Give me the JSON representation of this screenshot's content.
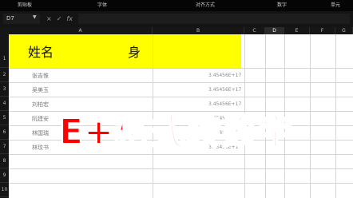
{
  "ribbon": {
    "groups": [
      "剪贴板",
      "字体",
      "对齐方式",
      "数字",
      "单元"
    ]
  },
  "formula_bar": {
    "name_box": "D7",
    "cancel": "×",
    "confirm": "✓",
    "fx": "fx"
  },
  "columns": [
    "A",
    "B",
    "C",
    "D",
    "E",
    "F",
    "G"
  ],
  "rows": [
    "1",
    "2",
    "3",
    "4",
    "5",
    "6",
    "7",
    "8",
    "9",
    "10"
  ],
  "header": {
    "name": "姓名",
    "id": "身"
  },
  "records": [
    {
      "name": "张吉惟",
      "id": "3.45456E+17"
    },
    {
      "name": "吴美玉",
      "id": "3.45456E+17"
    },
    {
      "name": "刘柏宏",
      "id": "3.45456E+17"
    },
    {
      "name": "阮建安",
      "id": "3.45456E+17"
    },
    {
      "name": "林国瑞",
      "id": "3.45456E+17"
    },
    {
      "name": "林玟书",
      "id": "3.45456E+17"
    }
  ],
  "overlay_title": "E+格式转数字",
  "colors": {
    "highlight": "#ffff00",
    "title": "#ff0000"
  }
}
